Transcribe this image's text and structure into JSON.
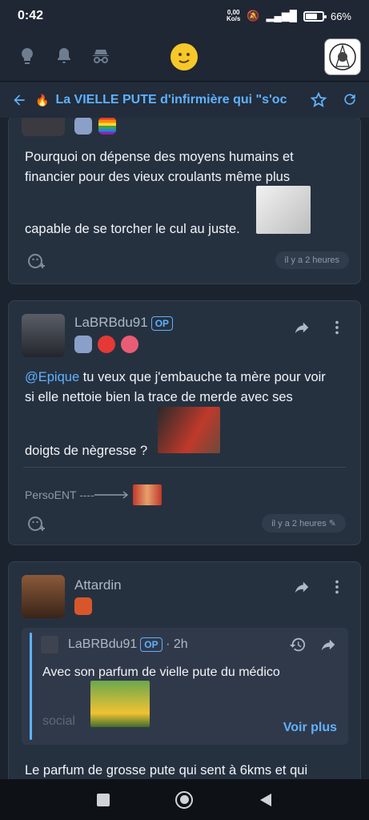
{
  "status": {
    "time": "0:42",
    "speed_value": "0,00",
    "speed_unit": "Ko/s",
    "battery": "66%",
    "battery_level": 0.66
  },
  "topic": {
    "title": "La VIELLE PUTE d'infirmière qui \"s'oc"
  },
  "posts": [
    {
      "text_line1": "Pourquoi on dépense des moyens humains et",
      "text_line2": "financier pour des vieux croulants même plus",
      "text_line3": "capable de se torcher le cul au juste.",
      "time": "il y a 2 heures"
    },
    {
      "author": "LaBRBdu91",
      "op": "OP",
      "mention": "@Epique",
      "text_a": " tu veux que j'embauche ta mère pour voir",
      "text_b": "si elle nettoie bien la trace de merde avec ses",
      "text_c": "doigts de nègresse ?",
      "signature": "PersoENT ----",
      "time": "il y a 2 heures"
    },
    {
      "author": "Attardin",
      "quote": {
        "author": "LaBRBdu91",
        "op": "OP",
        "age": "· 2h",
        "text": "Avec son parfum de vielle pute du médico",
        "faded": "social",
        "more": "Voir plus"
      },
      "text": "Le parfum de grosse pute qui sent à 6kms et qui"
    }
  ],
  "colors": {
    "accent": "#5fb2ff",
    "card": "#263140",
    "background": "#1b232e"
  }
}
